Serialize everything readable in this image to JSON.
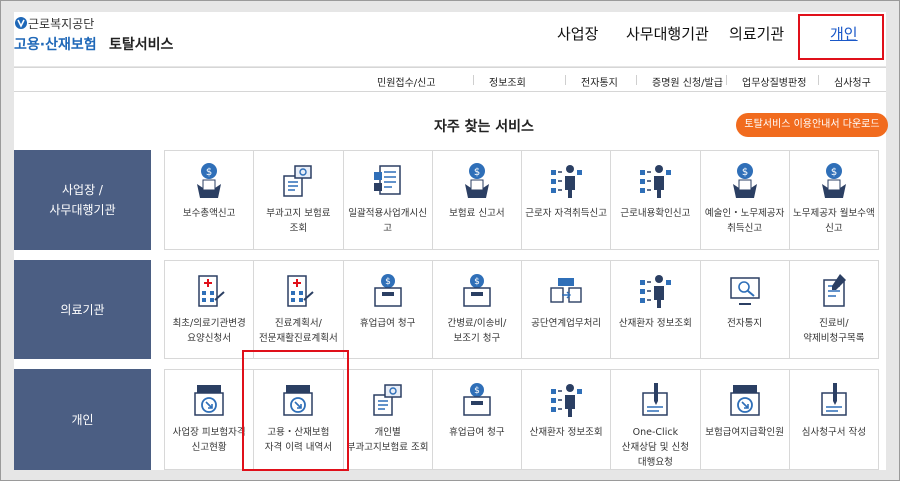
{
  "header": {
    "org_name": "근로복지공단",
    "title_main": "고용·산재보험",
    "title_sub": "토탈서비스",
    "logo_icon": "kcomwel-logo-icon",
    "nav": [
      "사업장",
      "사무대행기관",
      "의료기관",
      "개인"
    ],
    "nav_active": "개인"
  },
  "subnav": {
    "items": [
      "민원접수/신고",
      "정보조회",
      "전자통지",
      "증명원 신청/발급",
      "업무상질병판정",
      "심사청구"
    ]
  },
  "main": {
    "section_title": "자주 찾는 서비스",
    "guide_button": "토탈서비스 이용안내서 다운로드",
    "rows": [
      {
        "label": "사업장 /\n사무대행기관",
        "tiles": [
          {
            "icon": "coin-hand-icon",
            "label": "보수총액신고"
          },
          {
            "icon": "document-search-icon",
            "label": "부과고지 보험료 조회"
          },
          {
            "icon": "document-list-icon",
            "label": "일괄적용사업개시신고"
          },
          {
            "icon": "coin-hand-icon",
            "label": "보험료 신고서"
          },
          {
            "icon": "person-checklist-icon",
            "label": "근로자 자격취득신고"
          },
          {
            "icon": "person-checklist-icon",
            "label": "근로내용확인신고"
          },
          {
            "icon": "coin-hand-icon",
            "label": "예술인・노무제공자 취득신고"
          },
          {
            "icon": "coin-hand-icon",
            "label": "노무제공자 월보수액 신고"
          }
        ]
      },
      {
        "label": "의료기관",
        "tiles": [
          {
            "icon": "hospital-building-icon",
            "label": "최초/의료기관변경 요양신청서"
          },
          {
            "icon": "hospital-building-icon",
            "label": "진료계획서/전문재활진료계획서"
          },
          {
            "icon": "coin-box-icon",
            "label": "휴업급여 청구"
          },
          {
            "icon": "coin-box-icon",
            "label": "간병료/이송비/보조기 청구"
          },
          {
            "icon": "folder-exchange-icon",
            "label": "공단연계업무처리"
          },
          {
            "icon": "person-checklist-icon",
            "label": "산재환자 정보조회"
          },
          {
            "icon": "monitor-search-icon",
            "label": "전자통지"
          },
          {
            "icon": "pencil-document-icon",
            "label": "진료비/약제비청구목록"
          }
        ]
      },
      {
        "label": "개인",
        "tiles": [
          {
            "icon": "download-tray-icon",
            "label": "사업장 피보험자격 신고현황"
          },
          {
            "icon": "download-tray-icon",
            "label": "고용・산재보험 자격 이력 내역서"
          },
          {
            "icon": "document-search-icon",
            "label": "개인별 부과고지보험료 조회"
          },
          {
            "icon": "coin-box-icon",
            "label": "휴업급여 청구"
          },
          {
            "icon": "person-checklist-icon",
            "label": "산재환자 정보조회"
          },
          {
            "icon": "pen-document-icon",
            "label": "One-Click 산재상담 및 신청 대행요청"
          },
          {
            "icon": "download-tray-icon",
            "label": "보험급여지급확인원"
          },
          {
            "icon": "pen-document-icon",
            "label": "심사청구서 작성"
          }
        ]
      }
    ]
  },
  "colors": {
    "row_label_bg": "#4b5e83",
    "accent_orange": "#f16b1e",
    "highlight_red": "#e0101a",
    "link_blue": "#1a58c8",
    "icon_blue": "#2f6fb8",
    "icon_navy": "#2b3f63"
  }
}
